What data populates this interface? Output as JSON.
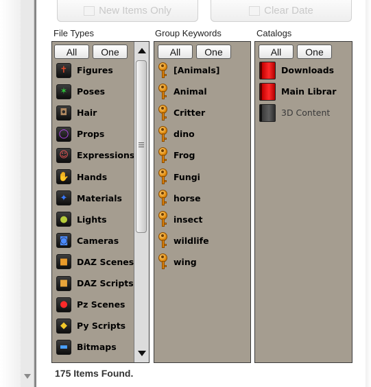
{
  "toolbar": {
    "new_items_label": "New Items Only",
    "clear_date_label": "Clear Date"
  },
  "file_types": {
    "header": "File Types",
    "all_label": "All",
    "one_label": "One",
    "items": [
      {
        "label": "Figures",
        "icon": "figure-icon",
        "glyph": "✝",
        "color": "#e04a2a"
      },
      {
        "label": "Poses",
        "icon": "pose-icon",
        "glyph": "✶",
        "color": "#2ec43a"
      },
      {
        "label": "Hair",
        "icon": "hair-icon",
        "glyph": "◘",
        "color": "#b08860"
      },
      {
        "label": "Props",
        "icon": "prop-icon",
        "glyph": "◯",
        "color": "#c04aff"
      },
      {
        "label": "Expressions",
        "icon": "expression-icon",
        "glyph": "☺",
        "color": "#ff5a5a"
      },
      {
        "label": "Hands",
        "icon": "hand-icon",
        "glyph": "✋",
        "color": "#ff4040"
      },
      {
        "label": "Materials",
        "icon": "material-icon",
        "glyph": "✦",
        "color": "#3a7aff"
      },
      {
        "label": "Lights",
        "icon": "light-icon",
        "glyph": "●",
        "color": "#b6cc3a"
      },
      {
        "label": "Cameras",
        "icon": "camera-icon",
        "glyph": "◙",
        "color": "#4a8aff"
      },
      {
        "label": "DAZ Scenes",
        "icon": "daz-scene-icon",
        "glyph": "■",
        "color": "#e89a2a"
      },
      {
        "label": "DAZ Scripts",
        "icon": "daz-script-icon",
        "glyph": "■",
        "color": "#e8a43a"
      },
      {
        "label": "Pz Scenes",
        "icon": "pz-scene-icon",
        "glyph": "●",
        "color": "#ff2a2a"
      },
      {
        "label": "Py Scripts",
        "icon": "py-script-icon",
        "glyph": "◆",
        "color": "#f2c82a"
      },
      {
        "label": "Bitmaps",
        "icon": "bitmap-icon",
        "glyph": "▬",
        "color": "#4aa0ff"
      }
    ]
  },
  "group_keywords": {
    "header": "Group Keywords",
    "all_label": "All",
    "one_label": "One",
    "items": [
      "[Animals]",
      "Animal",
      "Critter",
      "dino",
      "Frog",
      "Fungi",
      "horse",
      "insect",
      "wildlife",
      "wing"
    ]
  },
  "catalogs": {
    "header": "Catalogs",
    "all_label": "All",
    "one_label": "One",
    "items": [
      {
        "label": "Downloads",
        "color": "red",
        "dim": false
      },
      {
        "label": "Main Librar",
        "color": "red",
        "dim": false
      },
      {
        "label": "3D Content",
        "color": "gray",
        "dim": true
      }
    ]
  },
  "status": {
    "text": "175 Items Found."
  }
}
